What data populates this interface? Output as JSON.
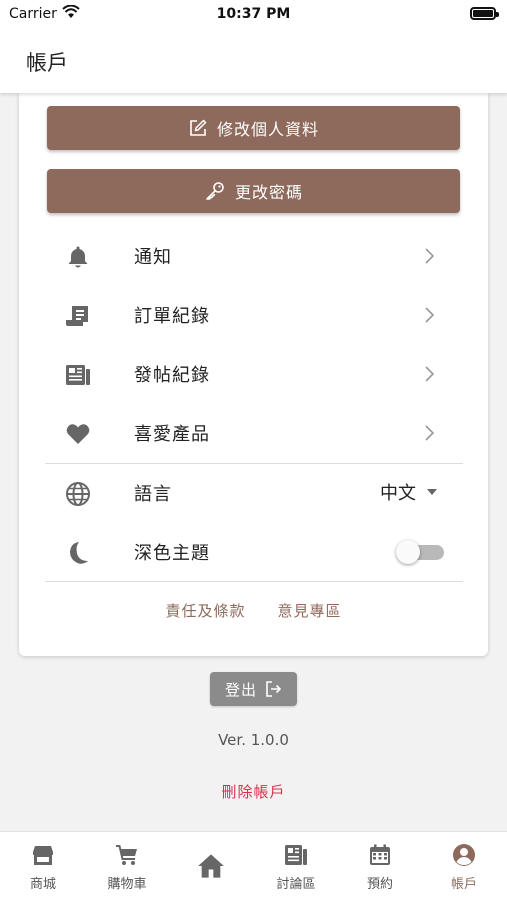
{
  "status_bar": {
    "carrier": "Carrier",
    "time": "10:37 PM"
  },
  "header": {
    "title": "帳戶"
  },
  "actions": {
    "edit_profile": "修改個人資料",
    "change_password": "更改密碼"
  },
  "menu": [
    {
      "label": "通知",
      "icon": "bell-icon"
    },
    {
      "label": "訂單紀錄",
      "icon": "receipt-icon"
    },
    {
      "label": "發帖紀錄",
      "icon": "newspaper-icon"
    },
    {
      "label": "喜愛產品",
      "icon": "heart-icon"
    }
  ],
  "settings": {
    "language": {
      "label": "語言",
      "value": "中文",
      "icon": "globe-icon"
    },
    "dark_theme": {
      "label": "深色主題",
      "enabled": false,
      "icon": "moon-icon"
    }
  },
  "links": {
    "terms": "責任及條款",
    "feedback": "意見專區"
  },
  "logout_label": "登出",
  "version": "Ver. 1.0.0",
  "delete_account": "刪除帳戶",
  "tabs": [
    {
      "label": "商城",
      "icon": "store-icon"
    },
    {
      "label": "購物車",
      "icon": "cart-icon"
    },
    {
      "label": "",
      "icon": "home-icon"
    },
    {
      "label": "討論區",
      "icon": "forum-icon"
    },
    {
      "label": "預約",
      "icon": "calendar-icon"
    },
    {
      "label": "帳戶",
      "icon": "account-icon",
      "active": true
    }
  ],
  "colors": {
    "accent": "#8e6a5d",
    "icon_gray": "#666666",
    "danger": "#d9304a",
    "logout_bg": "#8b8b8b"
  }
}
